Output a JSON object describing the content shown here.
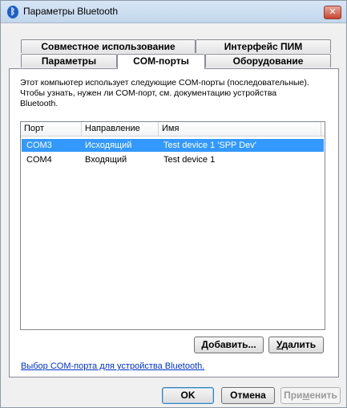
{
  "window": {
    "title": "Параметры Bluetooth",
    "close_glyph": "✕",
    "bt_glyph": "ᛒ"
  },
  "tabs": {
    "row1": [
      "Совместное использование",
      "Интерфейс ПИМ"
    ],
    "row2": [
      "Параметры",
      "COM-порты",
      "Оборудование"
    ],
    "active": "COM-порты"
  },
  "description": "Этот компьютер использует следующие COM-порты (последовательные). Чтобы узнать, нужен ли COM-порт, см. документацию устройства Bluetooth.",
  "table": {
    "columns": [
      "Порт",
      "Направление",
      "Имя"
    ],
    "rows": [
      {
        "port": "COM3",
        "direction": "Исходящий",
        "name": "Test device 1 'SPP Dev'",
        "selected": true
      },
      {
        "port": "COM4",
        "direction": "Входящий",
        "name": "Test device 1",
        "selected": false
      }
    ]
  },
  "buttons": {
    "add_accel": "Д",
    "add_rest": "обавить...",
    "remove_accel": "У",
    "remove_rest": "далить",
    "ok": "OK",
    "cancel": "Отмена",
    "apply_pre": "При",
    "apply_accel": "м",
    "apply_post": "енить"
  },
  "link": "Выбор COM-порта для устройства Bluetooth."
}
